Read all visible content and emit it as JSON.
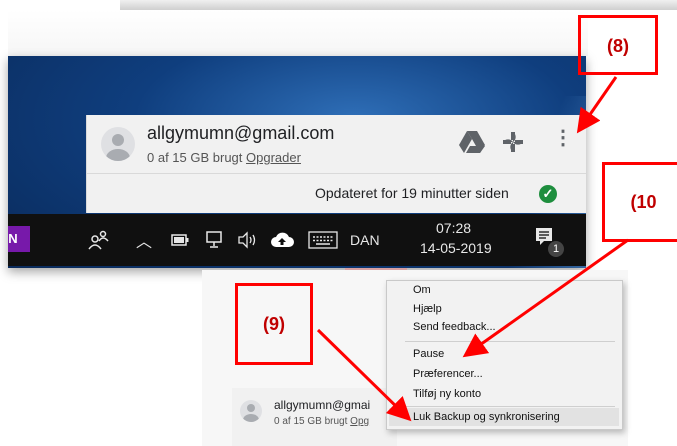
{
  "popup": {
    "email": "allgymumn@gmail.com",
    "quota_text": "0 af 15 GB brugt",
    "upgrade_link": "Opgrader",
    "status_text": "Opdateret for 19 minutter siden"
  },
  "taskbar": {
    "language": "DAN",
    "time": "07:28",
    "date": "14-05-2019",
    "notification_count": "1",
    "onenote_letter": "N"
  },
  "context_menu": {
    "items": [
      "Om",
      "Hjælp",
      "Send feedback...",
      "Pause",
      "Præferencer...",
      "Tilføj ny konto",
      "Luk Backup og synkronisering"
    ]
  },
  "lower_popup": {
    "email": "allgymumn@gmai",
    "quota_text": "0 af 15 GB brugt",
    "upgrade_partial": "Opg"
  },
  "annotations": {
    "label_8": "(8)",
    "label_9": "(9)",
    "label_10": "(10"
  },
  "colors": {
    "annotation": "#ff0000",
    "check_green": "#1e8e3e",
    "taskbar": "#101010",
    "onenote": "#7719aa"
  }
}
